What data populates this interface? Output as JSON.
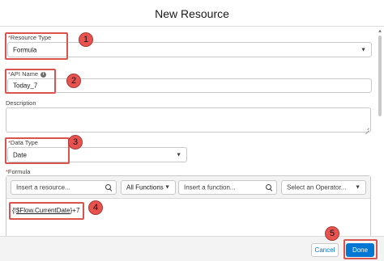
{
  "modal": {
    "title": "New Resource"
  },
  "fields": {
    "resource_type": {
      "required_mark": "*",
      "label": "Resource Type",
      "value": "Formula"
    },
    "api_name": {
      "required_mark": "*",
      "label": "API Name",
      "info_icon": "i",
      "value": "Today_7"
    },
    "description": {
      "label": "Description",
      "value": ""
    },
    "data_type": {
      "required_mark": "*",
      "label": "Data Type",
      "value": "Date"
    },
    "formula": {
      "required_mark": "*",
      "label": "Formula",
      "resource_search_placeholder": "Insert a resource...",
      "functions_filter_value": "All Functions",
      "function_search_placeholder": "Insert a function...",
      "operator_select_placeholder": "Select an Operator...",
      "expression_prefix": "{!",
      "expression_merge": "$Flow.CurrentDate",
      "expression_suffix": "}+7"
    }
  },
  "footer": {
    "cancel_label": "Cancel",
    "done_label": "Done"
  },
  "annotations": {
    "step1": "1",
    "step2": "2",
    "step3": "3",
    "step4": "4",
    "step5": "5",
    "highlight_color": "#d9534f"
  },
  "icons": {
    "dropdown": "chevron-down-icon",
    "search": "search-icon",
    "info": "info-icon"
  },
  "colors": {
    "brand_blue": "#0176d3",
    "required_red": "#c23934"
  }
}
